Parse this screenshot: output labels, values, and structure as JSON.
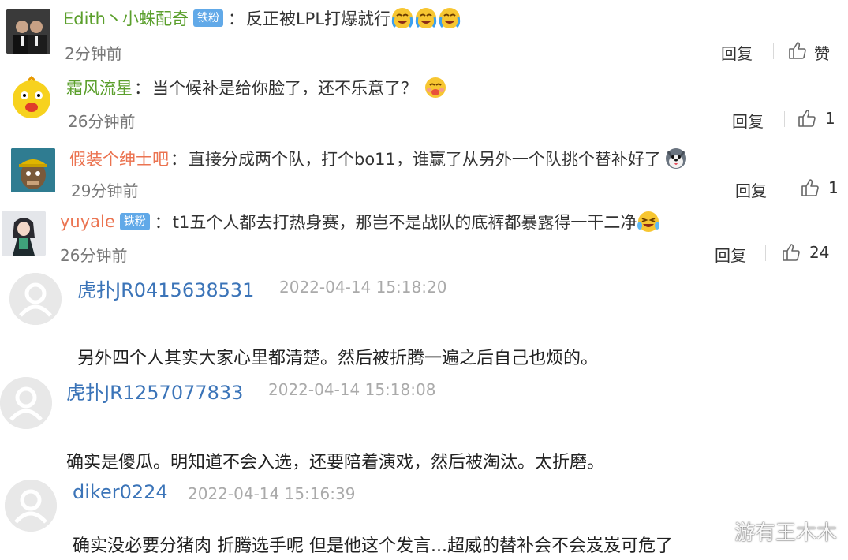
{
  "weibo_comments": [
    {
      "username": "Edith丶小蛛配奇",
      "username_color": "#5b9f2c",
      "badge": "铁粉",
      "text": "反正被LPL打爆就行",
      "emoji_names": [
        "crying-laugh-emoji",
        "crying-laugh-emoji",
        "crying-laugh-emoji"
      ],
      "time": "2分钟前",
      "reply_label": "回复",
      "like_label": "赞"
    },
    {
      "username": "霜风流星",
      "username_color": "#5b9f2c",
      "badge": "",
      "text": "当个候补是给你脸了，还不乐意了？",
      "emoji_names": [
        "yummy-face-emoji"
      ],
      "time": "26分钟前",
      "reply_label": "回复",
      "like_label": "1"
    },
    {
      "username": "假装个绅士吧",
      "username_color": "#eb7350",
      "badge": "",
      "text": "直接分成两个队，打个bo11，谁赢了从另外一个队挑个替补好了",
      "emoji_names": [
        "husky-dog-emoji"
      ],
      "time": "29分钟前",
      "reply_label": "回复",
      "like_label": "1"
    },
    {
      "username": "yuyale",
      "username_color": "#eb7350",
      "badge": "铁粉",
      "text": "t1五个人都去打热身赛，那岂不是战队的底裤都暴露得一干二净",
      "emoji_names": [
        "laugh-cry-emoji"
      ],
      "time": "26分钟前",
      "reply_label": "回复",
      "like_label": "24"
    }
  ],
  "hupu_comments": [
    {
      "username": "虎扑JR0415638531",
      "time": "2022-04-14 15:18:20",
      "text": "另外四个人其实大家心里都清楚。然后被折腾一遍之后自己也烦的。"
    },
    {
      "username": "虎扑JR1257077833",
      "time": "2022-04-14 15:18:08",
      "text": "确实是傻瓜。明知道不会入选，还要陪着演戏，然后被淘汰。太折磨。"
    },
    {
      "username": "diker0224",
      "time": "2022-04-14 15:16:39",
      "text": "确实没必要分猪肉 折腾选手呢 但是他这个发言...超威的替补会不会岌岌可危了"
    }
  ],
  "watermark": "游有王木木"
}
